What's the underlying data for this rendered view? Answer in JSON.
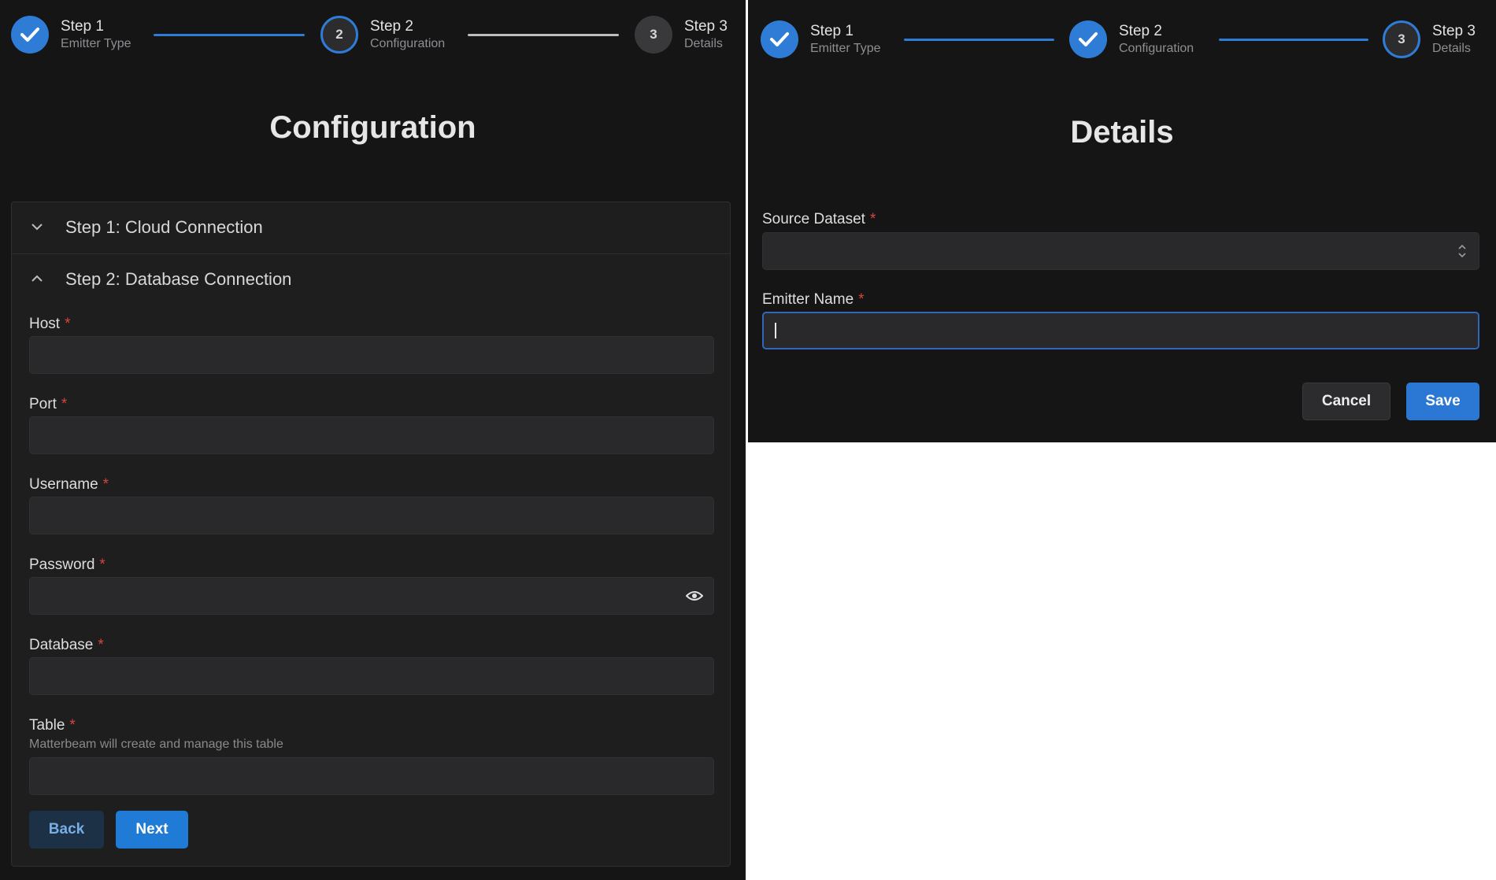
{
  "left": {
    "stepper": [
      {
        "title": "Step 1",
        "sub": "Emitter Type",
        "state": "done",
        "num": ""
      },
      {
        "title": "Step 2",
        "sub": "Configuration",
        "state": "active",
        "num": "2"
      },
      {
        "title": "Step 3",
        "sub": "Details",
        "state": "pending",
        "num": "3"
      }
    ],
    "title": "Configuration",
    "accordion": {
      "section1": "Step 1: Cloud Connection",
      "section2": "Step 2: Database Connection"
    },
    "fields": {
      "host": {
        "label": "Host",
        "value": ""
      },
      "port": {
        "label": "Port",
        "value": ""
      },
      "username": {
        "label": "Username",
        "value": ""
      },
      "password": {
        "label": "Password",
        "value": ""
      },
      "database": {
        "label": "Database",
        "value": ""
      },
      "table": {
        "label": "Table",
        "hint": "Matterbeam will create and manage this table",
        "value": ""
      }
    },
    "required_mark": "*",
    "buttons": {
      "back": "Back",
      "next": "Next"
    }
  },
  "right": {
    "stepper": [
      {
        "title": "Step 1",
        "sub": "Emitter Type",
        "state": "done",
        "num": ""
      },
      {
        "title": "Step 2",
        "sub": "Configuration",
        "state": "done",
        "num": ""
      },
      {
        "title": "Step 3",
        "sub": "Details",
        "state": "active",
        "num": "3"
      }
    ],
    "title": "Details",
    "fields": {
      "source_dataset": {
        "label": "Source Dataset",
        "value": ""
      },
      "emitter_name": {
        "label": "Emitter Name",
        "value": ""
      }
    },
    "buttons": {
      "cancel": "Cancel",
      "save": "Save"
    }
  },
  "colors": {
    "accent": "#2f7cd6",
    "background": "#151516",
    "required": "#d9453b"
  },
  "icons": [
    "check-icon",
    "chevron-down-icon",
    "chevron-up-icon",
    "eye-icon",
    "select-arrows-icon"
  ]
}
